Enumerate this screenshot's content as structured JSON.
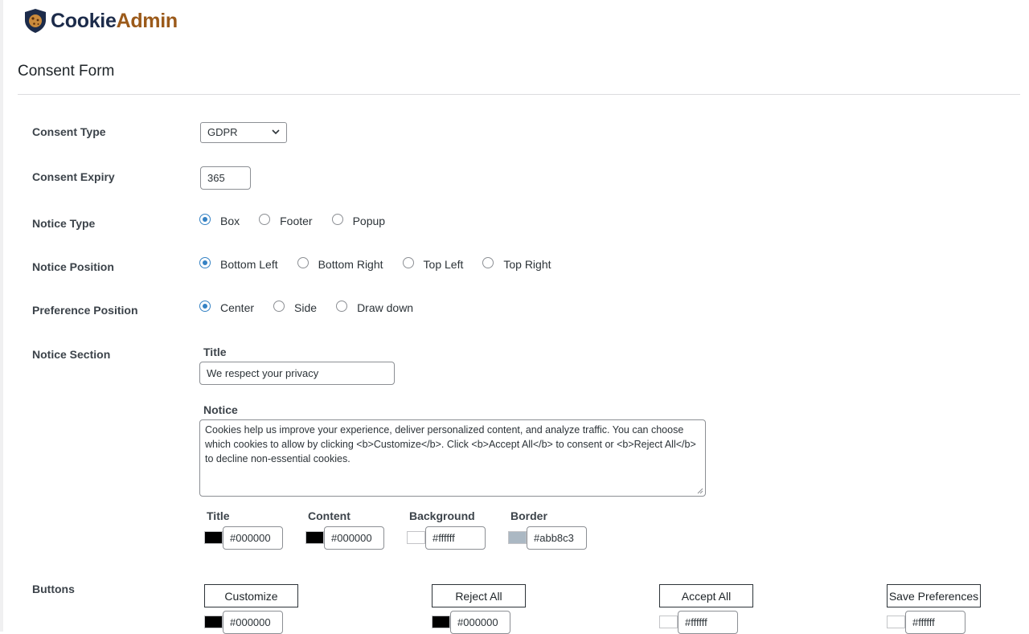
{
  "brand": {
    "name_part1": "Cookie",
    "name_part2": "Admin"
  },
  "page_title": "Consent Form",
  "consent_type": {
    "label": "Consent Type",
    "value": "GDPR"
  },
  "consent_expiry": {
    "label": "Consent Expiry",
    "value": "365"
  },
  "notice_type": {
    "label": "Notice Type",
    "options": [
      "Box",
      "Footer",
      "Popup"
    ],
    "selected": "Box"
  },
  "notice_position": {
    "label": "Notice Position",
    "options": [
      "Bottom Left",
      "Bottom Right",
      "Top Left",
      "Top Right"
    ],
    "selected": "Bottom Left"
  },
  "preference_position": {
    "label": "Preference Position",
    "options": [
      "Center",
      "Side",
      "Draw down"
    ],
    "selected": "Center"
  },
  "notice_section": {
    "label": "Notice Section",
    "title_label": "Title",
    "title_value": "We respect your privacy",
    "notice_label": "Notice",
    "notice_value": "Cookies help us improve your experience, deliver personalized content, and analyze traffic. You can choose which cookies to allow by clicking <b>Customize</b>. Click <b>Accept All</b> to consent or <b>Reject All</b> to decline non-essential cookies.",
    "colors": [
      {
        "label": "Title",
        "value": "#000000",
        "swatch": "#000000"
      },
      {
        "label": "Content",
        "value": "#000000",
        "swatch": "#000000"
      },
      {
        "label": "Background",
        "value": "#ffffff",
        "swatch": "#ffffff"
      },
      {
        "label": "Border",
        "value": "#abb8c3",
        "swatch": "#abb8c3"
      }
    ]
  },
  "buttons": {
    "label": "Buttons",
    "items": [
      {
        "label": "Customize",
        "color": "#000000",
        "swatch": "#000000"
      },
      {
        "label": "Reject All",
        "color": "#000000",
        "swatch": "#000000"
      },
      {
        "label": "Accept All",
        "color": "#ffffff",
        "swatch": "#ffffff"
      },
      {
        "label": "Save Preferences",
        "color": "#ffffff",
        "swatch": "#ffffff"
      }
    ]
  },
  "icons": {
    "logo": "shield-cookie-icon",
    "select_arrow": "chevron-down-icon",
    "resize": "resize-handle-icon"
  }
}
